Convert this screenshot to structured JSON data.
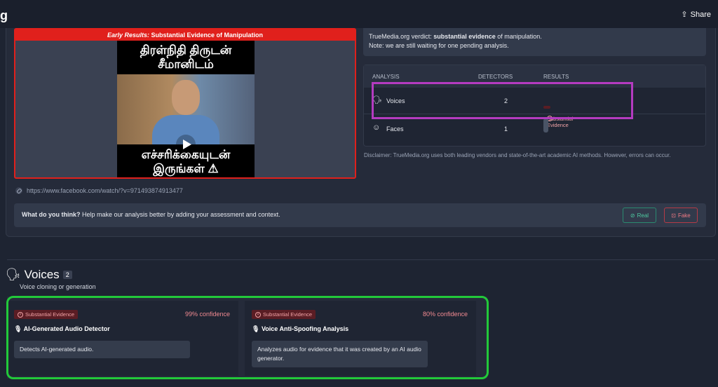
{
  "header": {
    "logo_fragment": "g",
    "share_label": "Share"
  },
  "video": {
    "banner_prefix": "Early Results:",
    "banner_text": "Substantial Evidence of Manipulation",
    "caption_top_1": "திரள்நிதி திருடன்",
    "caption_top_2": "சீமானிடம்",
    "caption_bottom_1": "எச்சரிக்கையுடன்",
    "caption_bottom_2": "இருங்கள் ⚠"
  },
  "source_url": "https://www.facebook.com/watch/?v=971493874913477",
  "verdict": {
    "prefix": "TrueMedia.org verdict: ",
    "strong": "substantial evidence",
    "suffix": " of manipulation.",
    "note": "Note: we are still waiting for one pending analysis."
  },
  "analysis_table": {
    "headers": {
      "analysis": "ANALYSIS",
      "detectors": "DETECTORS",
      "results": "RESULTS"
    },
    "rows": [
      {
        "name": "Voices",
        "detectors": "2",
        "result": "Substantial Evidence"
      },
      {
        "name": "Faces",
        "detectors": "1",
        "result": ""
      }
    ]
  },
  "disclaimer": "Disclaimer: TrueMedia.org uses both leading vendors and state-of-the-art academic AI methods. However, errors can occur.",
  "feedback": {
    "strong": "What do you think?",
    "text": " Help make our analysis better by adding your assessment and context.",
    "real_label": "Real",
    "fake_label": "Fake"
  },
  "voices_section": {
    "title": "Voices",
    "count": "2",
    "subtitle": "Voice cloning or generation",
    "cards": [
      {
        "badge": "Substantial Evidence",
        "confidence": "99% confidence",
        "name": "AI-Generated Audio Detector",
        "desc": "Detects AI-generated audio."
      },
      {
        "badge": "Substantial Evidence",
        "confidence": "80% confidence",
        "name": "Voice Anti-Spoofing Analysis",
        "desc": "Analyzes audio for evidence that it was created by an AI audio generator."
      }
    ]
  },
  "colors": {
    "accent_red": "#e0201c",
    "highlight_purple": "#b43bc0",
    "highlight_green": "#22c93a"
  }
}
